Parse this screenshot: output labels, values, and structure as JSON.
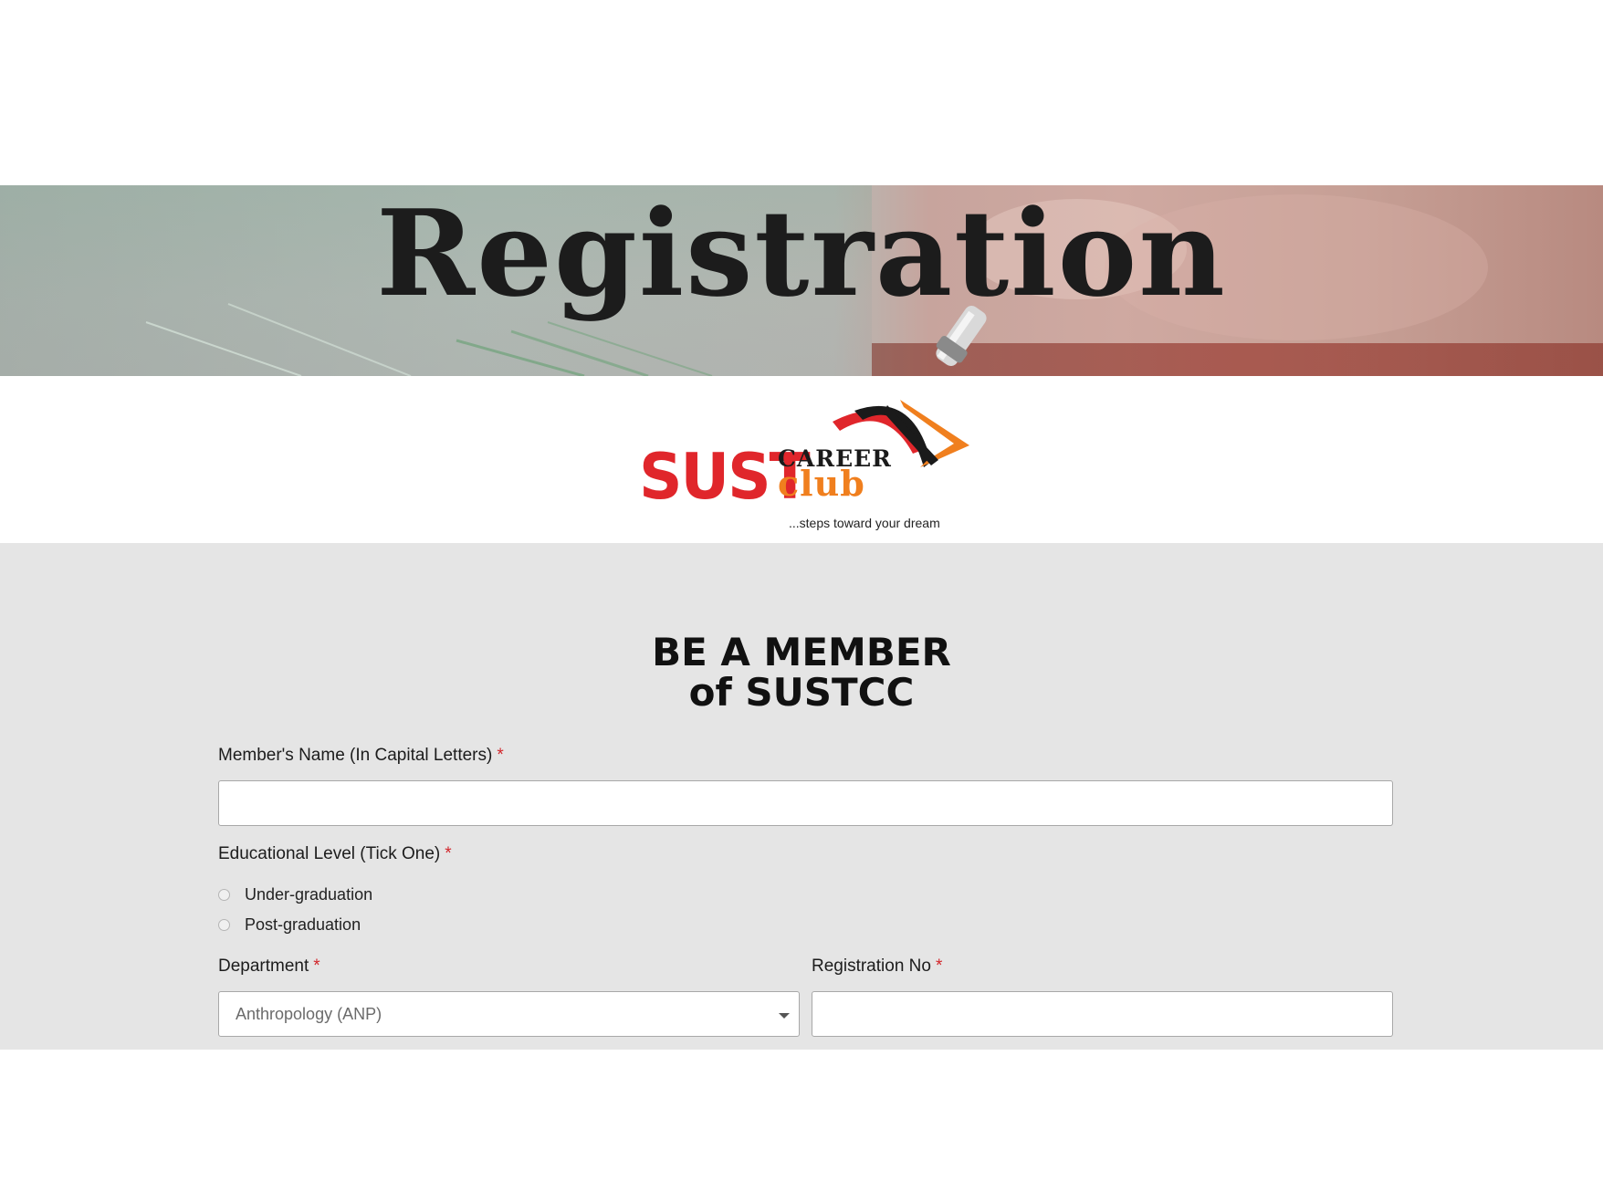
{
  "banner": {
    "title": "Registration"
  },
  "logo": {
    "primary": "SUST",
    "career": "CAREER",
    "club": "club",
    "tagline": "...steps toward your dream",
    "colors": {
      "red": "#e0262b",
      "orange": "#f07f1e",
      "black": "#1a1a1a"
    }
  },
  "form": {
    "heading_line1": "BE A MEMBER",
    "heading_line2": "of SUSTCC",
    "required_marker": "*",
    "name": {
      "label": "Member's Name (In Capital Letters)",
      "value": ""
    },
    "education": {
      "label": "Educational Level (Tick One)",
      "options": [
        "Under-graduation",
        "Post-graduation"
      ],
      "selected": null
    },
    "department": {
      "label": "Department",
      "selected_value": "Anthropology (ANP)"
    },
    "registration": {
      "label": "Registration No",
      "value": ""
    }
  },
  "colors": {
    "form_background": "#e5e5e5",
    "required": "#d2262b"
  }
}
